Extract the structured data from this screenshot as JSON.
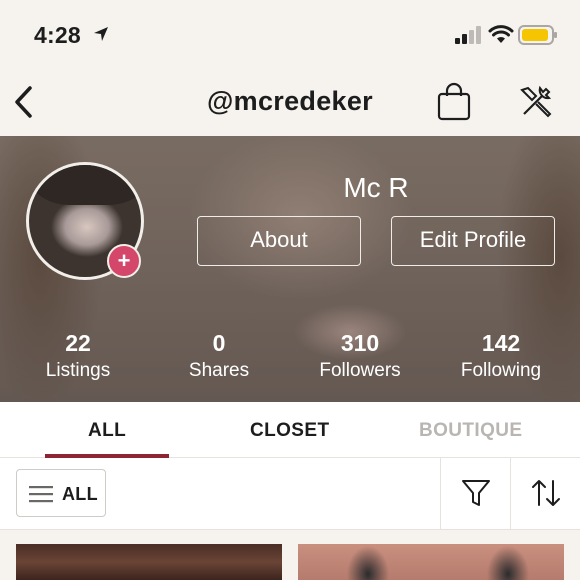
{
  "status_bar": {
    "time": "4:28"
  },
  "nav": {
    "title": "@mcredeker"
  },
  "profile": {
    "name": "Mc R",
    "about_label": "About",
    "edit_label": "Edit Profile",
    "add_badge": "+",
    "stats": [
      {
        "value": "22",
        "label": "Listings"
      },
      {
        "value": "0",
        "label": "Shares"
      },
      {
        "value": "310",
        "label": "Followers"
      },
      {
        "value": "142",
        "label": "Following"
      }
    ]
  },
  "tabs": [
    {
      "label": "ALL",
      "selected": true
    },
    {
      "label": "CLOSET",
      "selected": false
    },
    {
      "label": "BOUTIQUE",
      "selected": false
    }
  ],
  "filters": {
    "all_label": "ALL"
  },
  "colors": {
    "accent": "#8e2334",
    "plus": "#d5476a",
    "battery": "#f4c500"
  },
  "icons": [
    "back-chevron-icon",
    "shopping-bag-icon",
    "tools-icon",
    "hamburger-icon",
    "filter-funnel-icon",
    "sort-arrows-icon"
  ]
}
